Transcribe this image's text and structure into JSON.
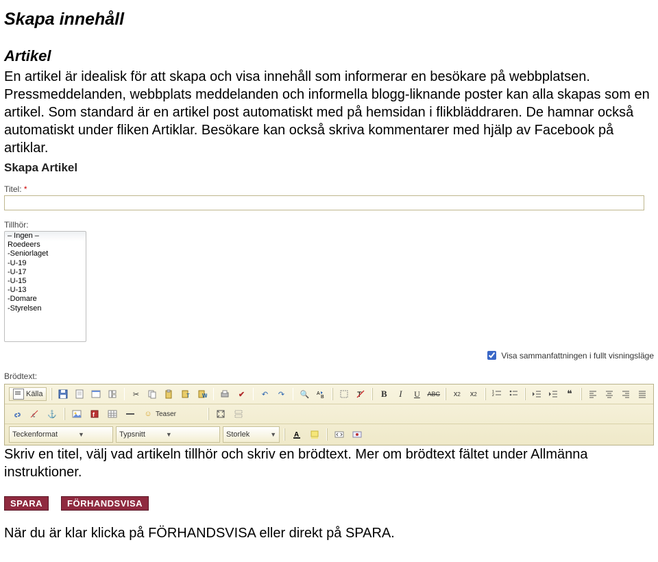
{
  "heading": "Skapa innehåll",
  "subheading": "Artikel",
  "para": "En artikel är idealisk för att skapa och visa innehåll som informerar en besökare på webbplatsen. Pressmeddelanden, webbplats meddelanden och informella blogg-liknande poster kan alla skapas som en artikel. Som standard är en artikel post automatiskt med på hemsidan i flikbläddraren. De hamnar också automatiskt under fliken Artiklar. Besökare kan också skriva kommentarer med hjälp av Facebook på artiklar.",
  "form": {
    "title_label": "Skapa Artikel",
    "titel_label": "Titel:",
    "star": "*",
    "tillhor_label": "Tillhör:",
    "options": [
      "– Ingen –",
      "Roedeers",
      "-Seniorlaget",
      "-U-19",
      "-U-17",
      "-U-15",
      "-U-13",
      "-Domare",
      "-Styrelsen"
    ],
    "summary_check": "Visa sammanfattningen i fullt visningsläge",
    "brodtext_label": "Brödtext:",
    "kalla": "Källa",
    "teckenformat": "Teckenformat",
    "typsnitt": "Typsnitt",
    "storlek": "Storlek",
    "letters": {
      "B": "B",
      "I": "I",
      "U": "U",
      "ABC": "ABC"
    }
  },
  "instr": "Skriv en titel, välj vad artikeln tillhör och skriv en brödtext. Mer om brödtext fältet under Allmänna instruktioner.",
  "buttons": {
    "save": "SPARA",
    "preview": "FÖRHANDSVISA"
  },
  "last": "När du är klar klicka på FÖRHANDSVISA eller direkt på SPARA."
}
